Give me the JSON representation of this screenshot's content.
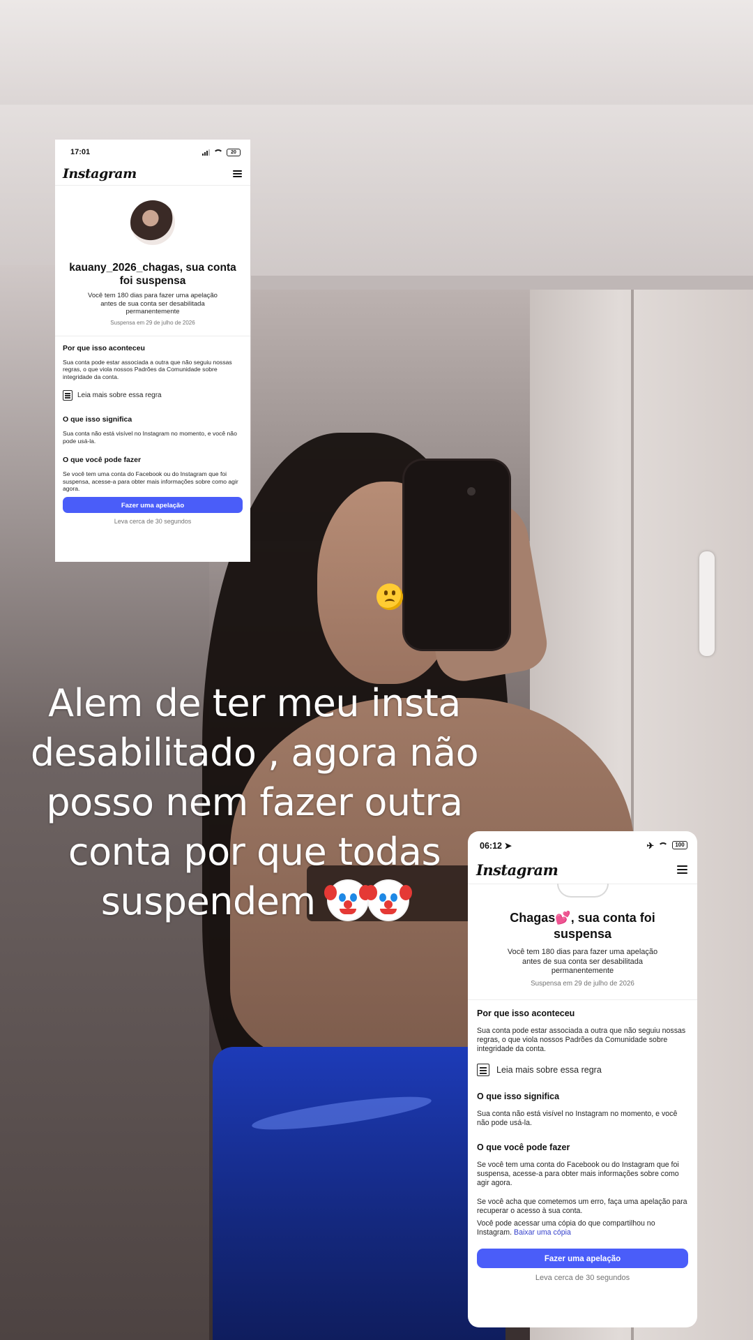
{
  "caption": {
    "line1": "Alem de ter meu insta",
    "line2": "desabilitado , agora não",
    "line3": "posso nem fazer outra",
    "line4": "conta por que todas",
    "line5": "suspendem",
    "emoji": "clown-face-emoji x2"
  },
  "sticker": {
    "icon": "upside-down-face-emoji"
  },
  "card1": {
    "status": {
      "time": "17:01",
      "battery": "20"
    },
    "header": {
      "logo": "Instagram"
    },
    "title": "kauany_2026_chagas, sua conta foi suspensa",
    "subtitle": "Você tem 180 dias para fazer uma apelação antes de sua conta ser desabilitada permanentemente",
    "suspended_date": "Suspensa em 29 de julho de 2026",
    "why_heading": "Por que isso aconteceu",
    "why_text": "Sua conta pode estar associada a outra que não seguiu nossas regras, o que viola nossos Padrões da Comunidade sobre integridade da conta.",
    "rule_link": "Leia mais sobre essa regra",
    "meaning_heading": "O que isso significa",
    "meaning_text": "Sua conta não está visível no Instagram no momento, e você não pode usá-la.",
    "todo_heading": "O que você pode fazer",
    "todo_text": "Se você tem uma conta do Facebook ou do Instagram que foi suspensa, acesse-a para obter mais informações sobre como agir agora.",
    "appeal_button": "Fazer uma apelação",
    "appeal_note": "Leva cerca de 30 segundos"
  },
  "card2": {
    "status": {
      "time": "06:12",
      "battery": "100"
    },
    "header": {
      "logo": "Instagram"
    },
    "title": "Chagas💕, sua conta foi suspensa",
    "subtitle": "Você tem 180 dias para fazer uma apelação antes de sua conta ser desabilitada permanentemente",
    "suspended_date": "Suspensa em 29 de julho de 2026",
    "why_heading": "Por que isso aconteceu",
    "why_text": "Sua conta pode estar associada a outra que não seguiu nossas regras, o que viola nossos Padrões da Comunidade sobre integridade da conta.",
    "rule_link": "Leia mais sobre essa regra",
    "meaning_heading": "O que isso significa",
    "meaning_text": "Sua conta não está visível no Instagram no momento, e você não pode usá-la.",
    "todo_heading": "O que você pode fazer",
    "todo_text": "Se você tem uma conta do Facebook ou do Instagram que foi suspensa, acesse-a para obter mais informações sobre como agir agora.",
    "mistake_text": "Se você acha que cometemos um erro, faça uma apelação para recuperar o acesso à sua conta.",
    "copy_text": "Você pode acessar uma cópia do que compartilhou no Instagram.",
    "copy_link": "Baixar uma cópia",
    "appeal_button": "Fazer uma apelação",
    "appeal_note": "Leva cerca de 30 segundos"
  },
  "colors": {
    "button": "#4a5df9",
    "link": "#3440cc",
    "caption_text": "#ffffff"
  }
}
